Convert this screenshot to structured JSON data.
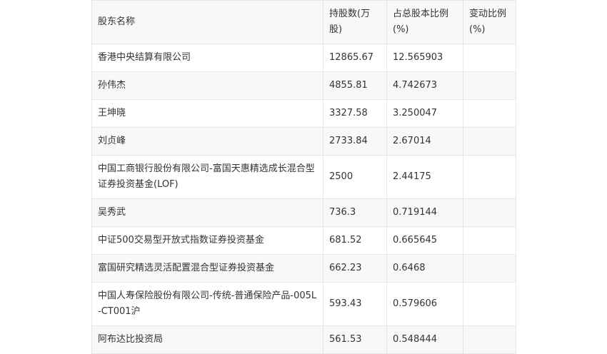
{
  "table": {
    "headers": [
      "股东名称",
      "持股数(万股)",
      "占总股本比例(%)",
      "变动比例(%)"
    ],
    "rows": [
      [
        "香港中央结算有限公司",
        "12865.67",
        "12.565903",
        ""
      ],
      [
        "孙伟杰",
        "4855.81",
        "4.742673",
        ""
      ],
      [
        "王坤晓",
        "3327.58",
        "3.250047",
        ""
      ],
      [
        "刘贞峰",
        "2733.84",
        "2.67014",
        ""
      ],
      [
        "中国工商银行股份有限公司-富国天惠精选成长混合型证券投资基金(LOF)",
        "2500",
        "2.44175",
        ""
      ],
      [
        "吴秀武",
        "736.3",
        "0.719144",
        ""
      ],
      [
        "中证500交易型开放式指数证券投资基金",
        "681.52",
        "0.665645",
        ""
      ],
      [
        "富国研究精选灵活配置混合型证券投资基金",
        "662.23",
        "0.6468",
        ""
      ],
      [
        "中国人寿保险股份有限公司-传统-普通保险产品-005L-CT001沪",
        "593.43",
        "0.579606",
        ""
      ],
      [
        "阿布达比投资局",
        "561.53",
        "0.548444",
        ""
      ]
    ]
  },
  "colors": {
    "border": "#e6e6e6",
    "header_bg": "#f7f8fa",
    "stripe_bg": "#f7f8fa",
    "text": "#333333"
  }
}
